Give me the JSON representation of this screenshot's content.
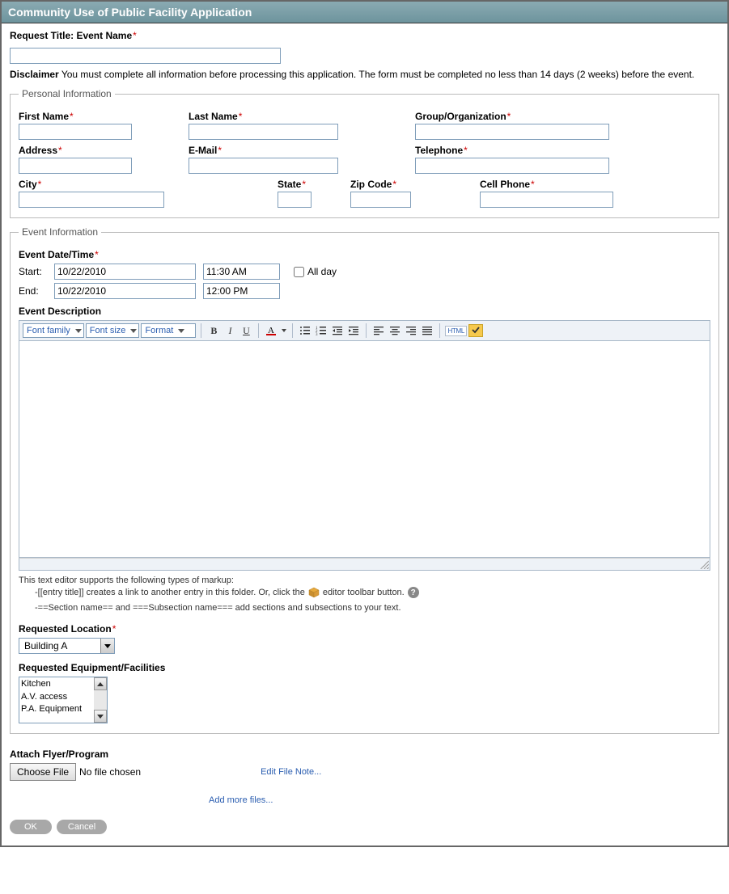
{
  "title": "Community Use of Public Facility Application",
  "request_title_label": "Request Title: Event Name",
  "request_title_value": "",
  "disclaimer_label": "Disclaimer",
  "disclaimer_text": "You must complete all information before processing this application. The form must be completed no less than 14 days (2 weeks) before the event.",
  "personal": {
    "legend": "Personal Information",
    "first_name_label": "First Name",
    "last_name_label": "Last Name",
    "group_label": "Group/Organization",
    "address_label": "Address",
    "email_label": "E-Mail",
    "telephone_label": "Telephone",
    "city_label": "City",
    "state_label": "State",
    "zip_label": "Zip Code",
    "cell_label": "Cell Phone",
    "first_name": "",
    "last_name": "",
    "group": "",
    "address": "",
    "email": "",
    "telephone": "",
    "city": "",
    "state": "",
    "zip": "",
    "cell": ""
  },
  "event": {
    "legend": "Event Information",
    "datetime_label": "Event Date/Time",
    "start_label": "Start:",
    "end_label": "End:",
    "start_date": "10/22/2010",
    "start_time": "11:30 AM",
    "end_date": "10/22/2010",
    "end_time": "12:00 PM",
    "all_day_label": "All day",
    "description_label": "Event Description",
    "toolbar": {
      "font_family": "Font family",
      "font_size": "Font size",
      "format": "Format",
      "html": "HTML"
    },
    "markup_intro": "This text editor supports the following types of markup:",
    "markup_line1_a": "-[[entry title]] creates a link to another entry in this folder. Or, click the",
    "markup_line1_b": "editor toolbar button.",
    "markup_line2": "-==Section name== and ===Subsection name=== add sections and subsections to your text.",
    "req_location_label": "Requested Location",
    "req_location_value": "Building A",
    "req_equip_label": "Requested Equipment/Facilities",
    "equipment": {
      "0": "Kitchen",
      "1": "A.V. access",
      "2": "P.A. Equipment"
    }
  },
  "attach": {
    "label": "Attach Flyer/Program",
    "choose_label": "Choose File",
    "no_file": "No file chosen",
    "edit_note": "Edit File Note...",
    "add_more": "Add more files..."
  },
  "buttons": {
    "ok": "OK",
    "cancel": "Cancel"
  }
}
